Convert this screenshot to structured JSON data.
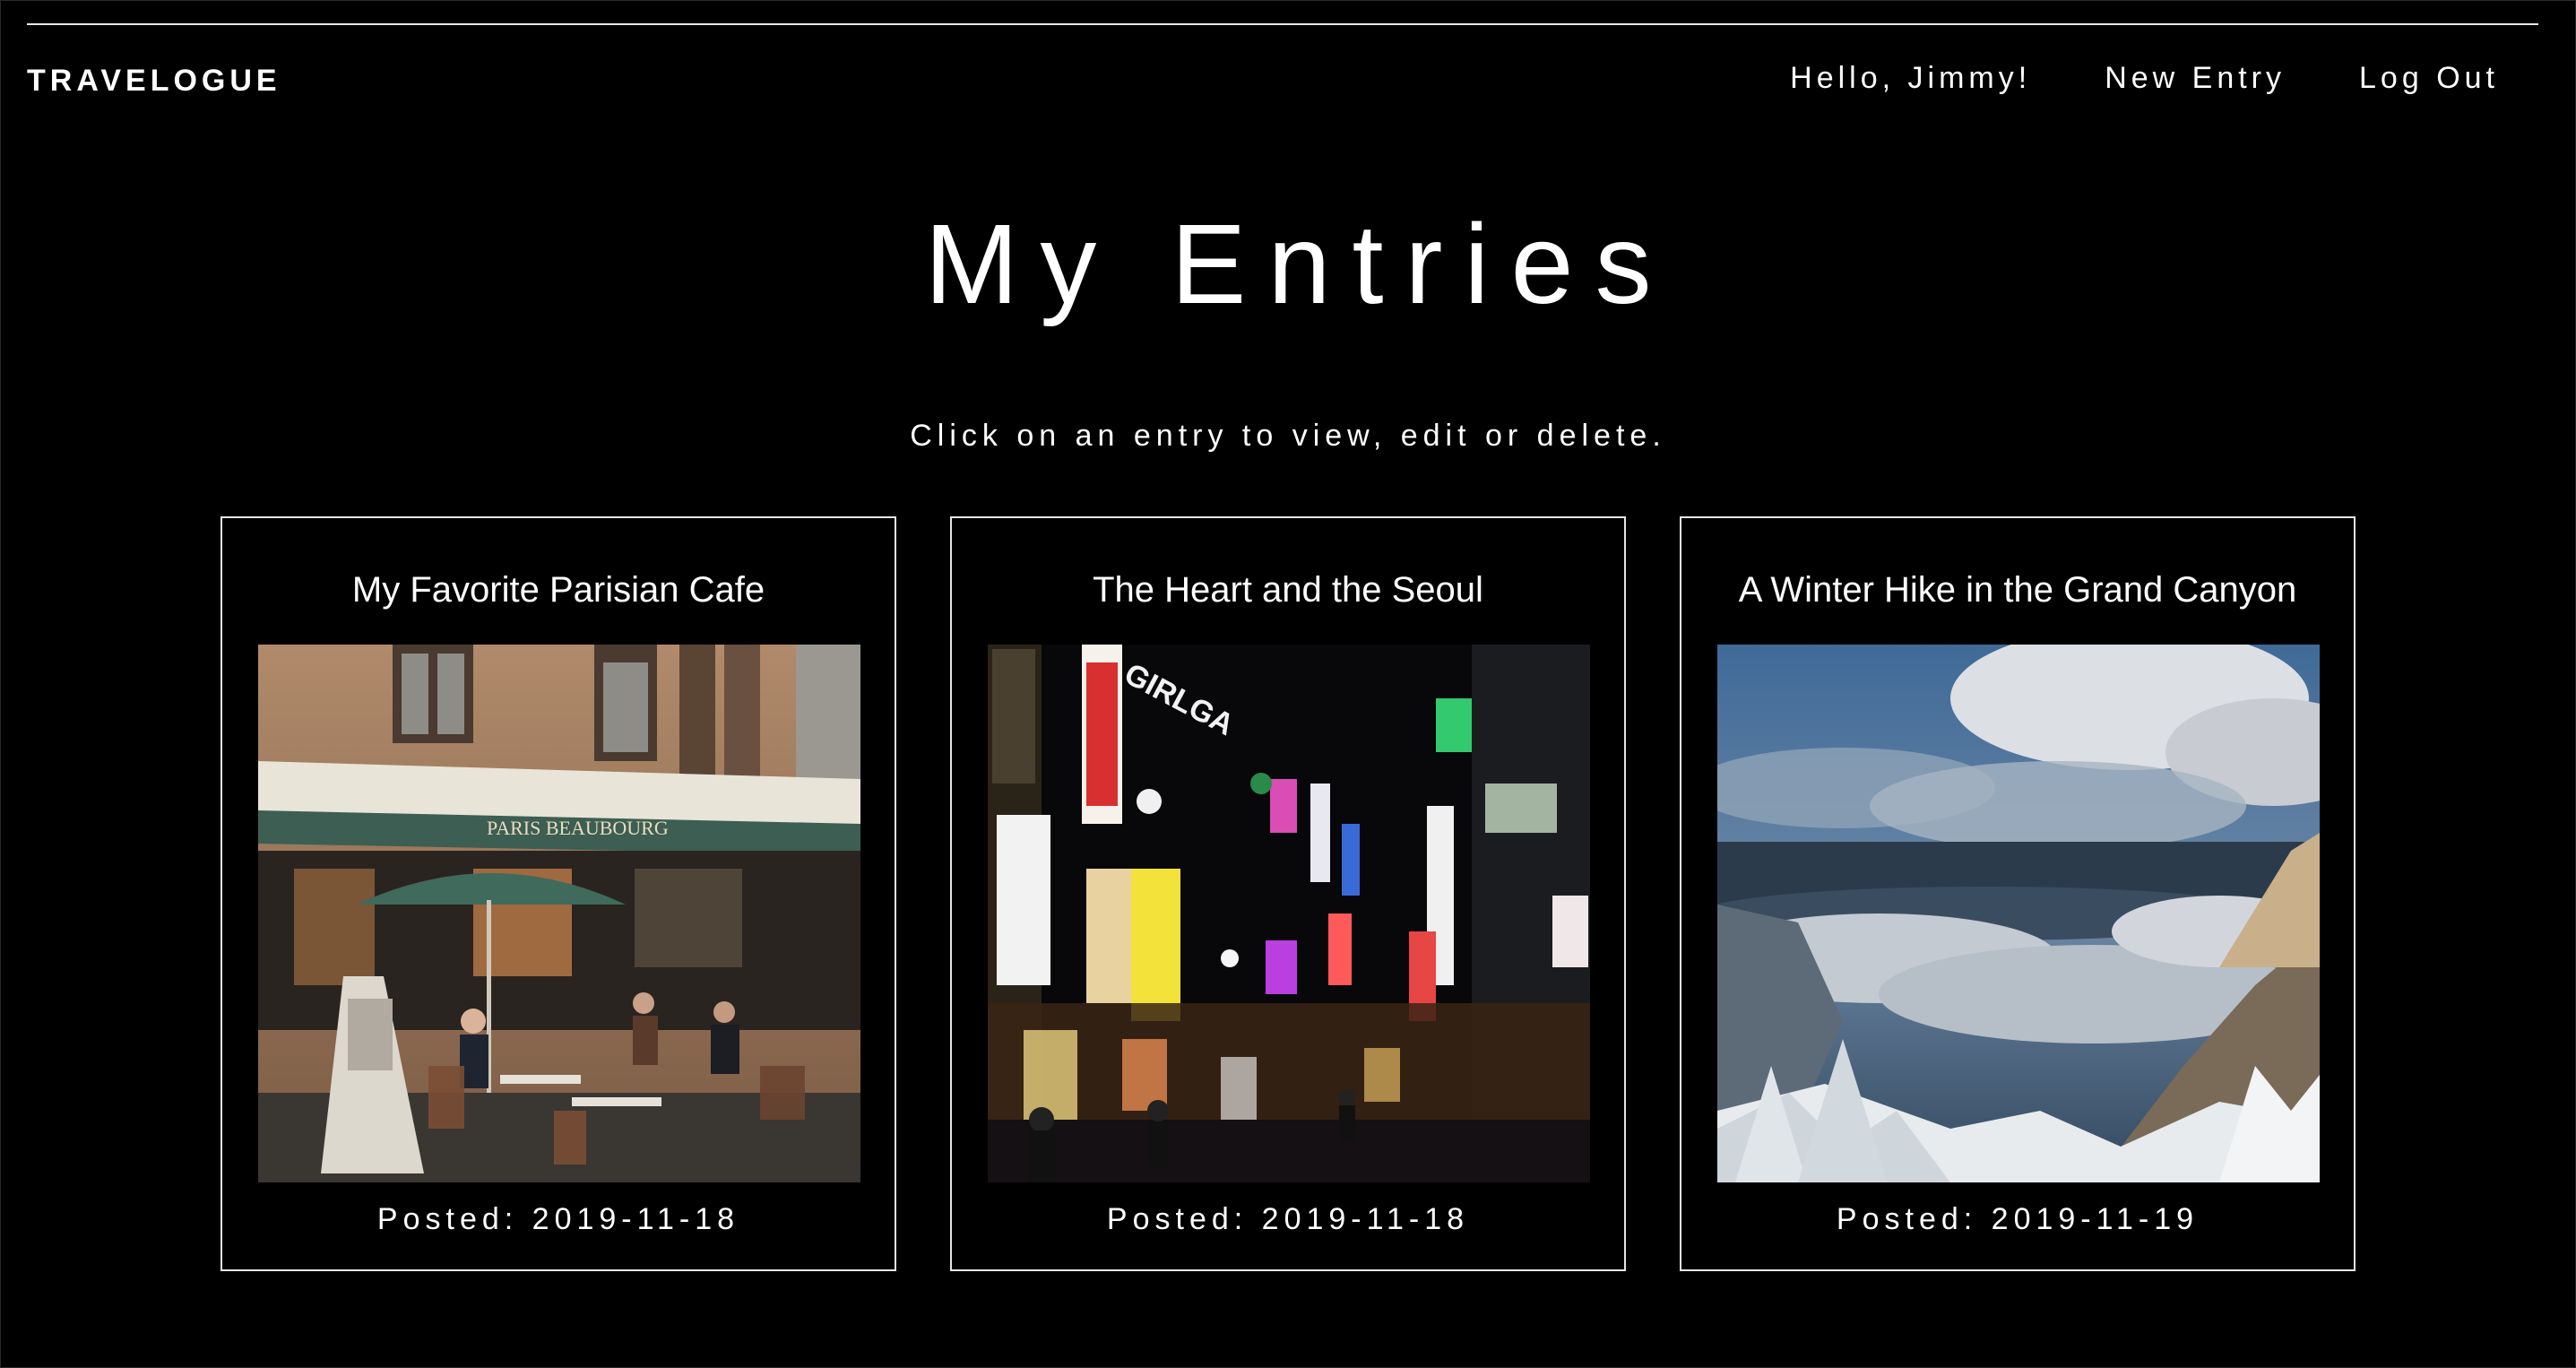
{
  "header": {
    "brand": "TRAVELOGUE",
    "greeting": "Hello, Jimmy!",
    "new_entry_label": "New Entry",
    "logout_label": "Log Out"
  },
  "main": {
    "title": "My Entries",
    "subtitle": "Click on an entry to view, edit or delete."
  },
  "entries": [
    {
      "title": "My Favorite Parisian Cafe",
      "posted": "Posted: 2019-11-18",
      "image": "paris-cafe-photo",
      "image_text": "PARIS BEAUBOURG"
    },
    {
      "title": "The Heart and the Seoul",
      "posted": "Posted: 2019-11-18",
      "image": "seoul-night-street-photo",
      "image_text": "GIRLGA"
    },
    {
      "title": "A Winter Hike in the Grand Canyon",
      "posted": "Posted: 2019-11-19",
      "image": "grand-canyon-winter-photo"
    }
  ],
  "colors": {
    "background": "#000000",
    "text": "#ffffff",
    "border": "#e6e6e6"
  }
}
